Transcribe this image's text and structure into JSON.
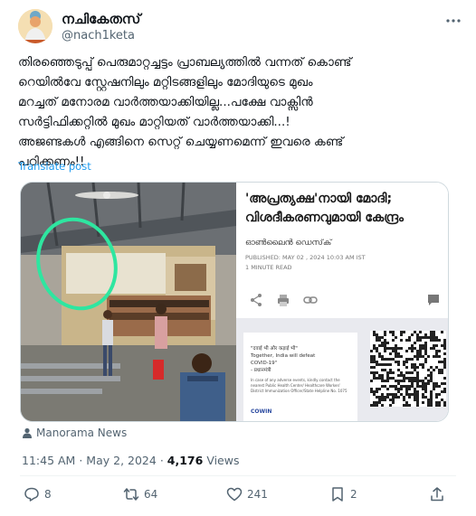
{
  "author": {
    "display_name": "നചികേതസ്",
    "handle": "@nach1keta",
    "more_icon": "more-horizontal-icon"
  },
  "tweet": {
    "text_lines": [
      "തിരഞ്ഞെടുപ്പ് പെരുമാറ്റച്ചട്ടം പ്രാബല്യത്തിൽ വന്നത് കൊണ്ട്",
      "റെയിൽവേ സ്റ്റേഷനിലും മറ്റിടങ്ങളിലും മോദിയുടെ മുഖം",
      "മറച്ചത് മനോരമ വാർത്തയാക്കിയില്ല...പക്ഷേ വാക്സിൻ",
      "സർട്ടിഫിക്കറ്റിൽ മുഖം മാറ്റിയത് വാർത്തയാക്കി...!",
      "അജണ്ടകൾ എങ്ങിനെ സെറ്റ് ചെയ്യണമെന്ന് ഇവരെ കണ്ട്",
      "പഠിക്കണം!!"
    ],
    "translate_label": "Translate post"
  },
  "article": {
    "title_line1": "'അപ്രത്യക്ഷ'നായി മോദി;",
    "title_line2": "വിശദീകരണവുമായി കേന്ദ്രം",
    "author": "ഓൺലൈൻ ഡെസ്‌ക്",
    "published": "PUBLISHED: MAY 02 , 2024 10:03 AM IST",
    "read_time": "1 MINUTE READ"
  },
  "certificate": {
    "hindi_quote_line1": "\"दवाई भी और कड़ाई भी\"",
    "english_line1": "Together, India will defeat",
    "english_line2": "COVID-19\"",
    "signature": "- प्रधानमंत्री",
    "tag": "In case of any adverse events, kindly contact the nearest Public Health Center/ Healthcare Worker/ District Immunization Officer/State Helpline No. 1075",
    "brand": "COWIN"
  },
  "source": {
    "label": "Manorama News",
    "icon": "person-icon"
  },
  "stats": {
    "time": "11:45 AM",
    "separator": "·",
    "date": "May 2, 2024",
    "views_count": "4,176",
    "views_label": "Views"
  },
  "actions": {
    "replies": "8",
    "reposts": "64",
    "likes": "241",
    "bookmarks": "2"
  },
  "colors": {
    "accent": "#1d9bf0",
    "muted": "#536471",
    "highlight_circle": "#2ee6a0"
  }
}
